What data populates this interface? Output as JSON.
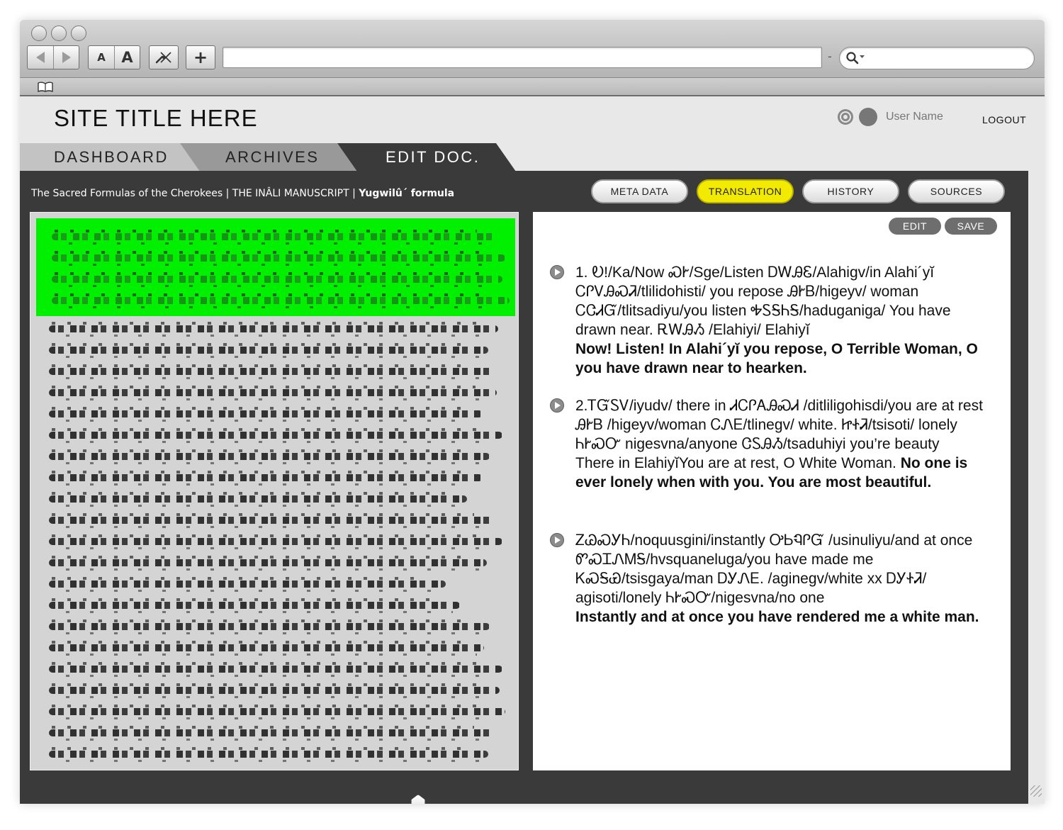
{
  "browser": {
    "buttons": {
      "font_small": "A",
      "font_large": "A",
      "new_tab": "+"
    },
    "icons": [
      "back-arrow-icon",
      "forward-arrow-icon",
      "tools-icon",
      "search-icon",
      "chevron-down-icon",
      "bookmarks-icon"
    ]
  },
  "header": {
    "site_title": "SITE TITLE HERE",
    "user_name": "User Name",
    "logout": "LOGOUT"
  },
  "nav": {
    "tabs": [
      {
        "label": "DASHBOARD"
      },
      {
        "label": "ARCHIVES"
      },
      {
        "label": "EDIT DOC."
      }
    ],
    "active_tab": "EDIT DOC."
  },
  "breadcrumb": {
    "part1": "The Sacred Formulas of the Cherokees | THE INÂLI MANUSCRIPT | ",
    "part2": "Yugwilû´ formula"
  },
  "doc_tabs": [
    {
      "label": "META DATA",
      "active": false
    },
    {
      "label": "TRANSLATION",
      "active": true
    },
    {
      "label": "HISTORY",
      "active": false
    },
    {
      "label": "SOURCES",
      "active": false
    }
  ],
  "translation": {
    "edit_label": "EDIT",
    "save_label": "SAVE",
    "entries": [
      {
        "text": "1. Ꭷ!/Ka/Now ᏍᎨ/Sge/Listen ᎠᎳᎯᏋ/Alahigv/in Alahi´yĭ ᏟᎵᏙᎯᏍᏘ/tlilidohisti/ you repose ᎯᎨᏴ/higeyv/ woman ᏟᏣᏗᏳ/tlitsadiyu/you listen ᎭᏚᎦᏂᎦ/haduganiga/ You have drawn near. ᎡᎳᎯᏱ /Elahiyi/ Elahiyĭ",
        "english": "Now! Listen! In Alahi´yĭ you repose, O Terrible Woman, O you have drawn near to hearken."
      },
      {
        "text": "2.ᎢᏳᏚᏙ/iyudv/ there in ᏗᏟᎵᎪᎯᏍᏗ /ditliligohisdi/you are at rest ᎯᎨᏴ /higeyv/woman ᏟᏁᎬ/tlinegv/ white. ᏥᏐᏘ/tsisoti/ lonely ᏂᎨᏍᏅ nigesvna/anyone ᏣᏚᎯᏱ/tsaduhiyi you’re beauty",
        "english_plain": "There in ElahiyĭYou are at rest, O White Woman. ",
        "english": "No one is ever lonely when with you. You are most beautiful."
      },
      {
        "text": "ᏃᏊᏍᎩᏂ/noquusgini/instantly ᎤᏏᏄᎵᏳ /usinuliyu/and at once ᏛᏍᏆᏁᎷᎦ/hvsquaneluga/you have made me ᏦᏍᎦᏯ/tsisgaya/man ᎠᎩᏁᎬ. /aginegv/white xx ᎠᎩᏐᏘ/ agisoti/lonely ᏂᎨᏍᏅ/nigesvna/no one",
        "english": "Instantly and at once you have rendered me a white man."
      }
    ]
  },
  "colors": {
    "accent": "#f2ea00",
    "manuscript_highlight": "#00f000",
    "panel_bg": "#3a3a3a"
  }
}
